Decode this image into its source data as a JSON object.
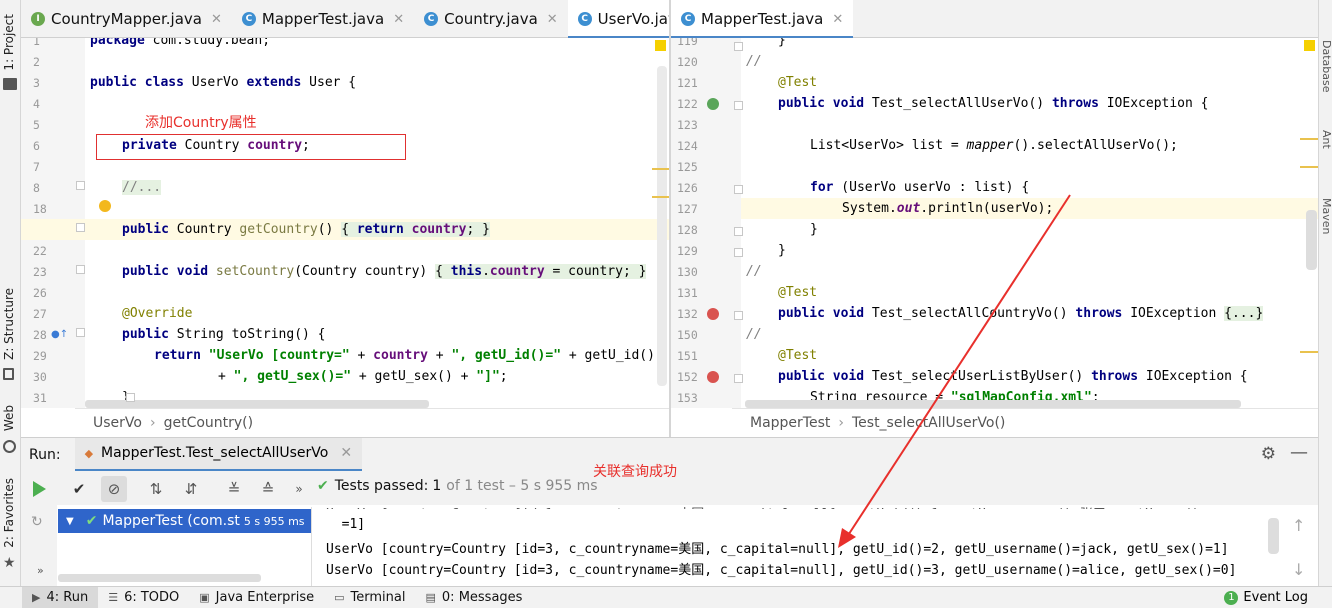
{
  "left_strip": {
    "project": "1: Project",
    "structure": "Z: Structure",
    "web": "Web",
    "favorites": "2: Favorites"
  },
  "right_strip": {
    "database": "Database",
    "ant": "Ant",
    "maven": "Maven"
  },
  "left_editor": {
    "tabs": [
      {
        "label": "CountryMapper.java",
        "icon": "I",
        "color": "#6aa84f"
      },
      {
        "label": "MapperTest.java",
        "icon": "C",
        "color": "#3d8fd1"
      },
      {
        "label": "Country.java",
        "icon": "C",
        "color": "#3d8fd1"
      },
      {
        "label": "UserVo.java",
        "icon": "C",
        "color": "#3d8fd1"
      }
    ],
    "line_numbers": [
      "1",
      "2",
      "3",
      "4",
      "5",
      "6",
      "7",
      "8",
      "18",
      "19",
      "22",
      "23",
      "26",
      "27",
      "28",
      "29",
      "30",
      "31"
    ],
    "breadcrumb": [
      "UserVo",
      "getCountry()"
    ],
    "annotation": "添加Country属性"
  },
  "right_editor": {
    "tabs": [
      {
        "label": "MapperTest.java",
        "icon": "C",
        "color": "#3d8fd1"
      }
    ],
    "line_numbers": [
      "119",
      "120",
      "121",
      "122",
      "123",
      "124",
      "125",
      "126",
      "127",
      "128",
      "129",
      "130",
      "131",
      "132",
      "150",
      "151",
      "152",
      "153"
    ],
    "breadcrumb": [
      "MapperTest",
      "Test_selectAllUserVo()"
    ]
  },
  "run": {
    "label": "Run:",
    "config": "MapperTest.Test_selectAllUserVo",
    "status": "Tests passed:",
    "passed": "1",
    "of_total": "of 1 test – 5 s 955 ms",
    "tree_item": "MapperTest (com.st",
    "tree_time": "5 s 955 ms",
    "annotation": "关联查询成功",
    "console": [
      "  =1]",
      "UserVo [country=Country [id=3, c_countryname=美国, c_capital=null], getU_id()=2, getU_username()=jack, getU_sex()=1]",
      "UserVo [country=Country [id=3, c_countryname=美国, c_capital=null], getU_id()=3, getU_username()=alice, getU_sex()=0]"
    ]
  },
  "bottom_tabs": [
    {
      "label": "4: Run",
      "icon": "run-icon"
    },
    {
      "label": "6: TODO",
      "icon": "todo-icon"
    },
    {
      "label": "Java Enterprise",
      "icon": "java-enterprise-icon"
    },
    {
      "label": "Terminal",
      "icon": "terminal-icon"
    },
    {
      "label": "0: Messages",
      "icon": "messages-icon"
    }
  ],
  "event_log": {
    "count": "1",
    "label": "Event Log"
  }
}
